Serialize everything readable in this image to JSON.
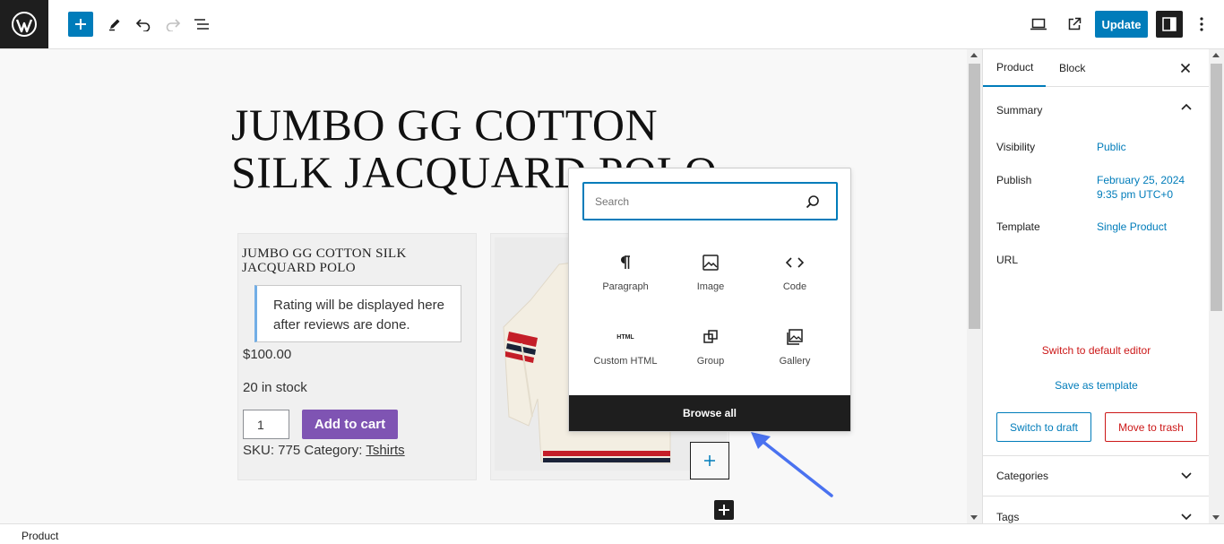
{
  "toolbar": {
    "update_label": "Update"
  },
  "post": {
    "title": "JUMBO GG COTTON SILK JACQUARD POLO",
    "product_name": "JUMBO GG COTTON SILK JACQUARD POLO",
    "rating_notice": "Rating will be displayed here after reviews are done.",
    "price": "$100.00",
    "stock": "20 in stock",
    "quantity": "1",
    "add_to_cart": "Add to cart",
    "sku_text": "SKU: 775 Category: ",
    "category_link": "Tshirts"
  },
  "inserter": {
    "search_placeholder": "Search",
    "blocks": [
      {
        "label": "Paragraph",
        "icon": "paragraph-icon"
      },
      {
        "label": "Image",
        "icon": "image-icon"
      },
      {
        "label": "Code",
        "icon": "code-icon"
      },
      {
        "label": "Custom HTML",
        "icon": "html-icon"
      },
      {
        "label": "Group",
        "icon": "group-icon"
      },
      {
        "label": "Gallery",
        "icon": "gallery-icon"
      }
    ],
    "html_icon_text": "HTML",
    "browse_all": "Browse all"
  },
  "sidebar": {
    "tabs": [
      "Product",
      "Block"
    ],
    "summary": {
      "heading": "Summary",
      "visibility_label": "Visibility",
      "visibility_value": "Public",
      "publish_label": "Publish",
      "publish_date": "February 25, 2024",
      "publish_time": "9:35 pm UTC+0",
      "template_label": "Template",
      "template_value": "Single Product",
      "url_label": "URL"
    },
    "switch_editor": "Switch to default editor",
    "save_template": "Save as template",
    "switch_draft": "Switch to draft",
    "move_trash": "Move to trash",
    "categories": "Categories",
    "tags": "Tags"
  },
  "footer": {
    "breadcrumb": "Product"
  },
  "colors": {
    "accent": "#007cba",
    "danger": "#cc1818",
    "cart_button": "#7f54b3",
    "dark": "#1e1e1e"
  }
}
